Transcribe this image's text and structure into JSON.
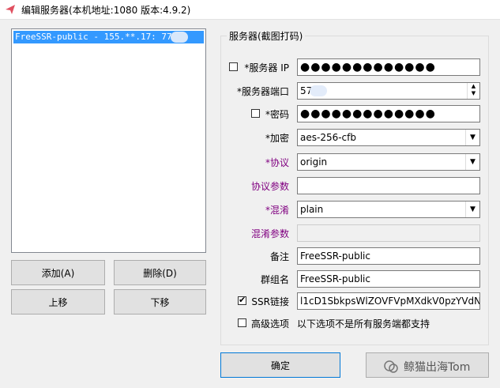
{
  "window": {
    "title": "编辑服务器(本机地址:1080 版本:4.9.2)"
  },
  "server_list": {
    "items": [
      "FreeSSR-public - 155.**.17:   77"
    ]
  },
  "buttons": {
    "add": "添加(A)",
    "delete": "删除(D)",
    "move_up": "上移",
    "move_down": "下移",
    "ok": "确定"
  },
  "form": {
    "group_title": "服务器(截图打码)",
    "server_ip": {
      "label": "*服务器 IP",
      "value": "●●●●●●●●●●●●●",
      "checked": false
    },
    "server_port": {
      "label": "*服务器端口",
      "value": "57"
    },
    "password": {
      "label": "*密码",
      "value": "●●●●●●●●●●●●●",
      "checked": false
    },
    "encryption": {
      "label": "*加密",
      "value": "aes-256-cfb"
    },
    "protocol": {
      "label": "*协议",
      "value": "origin"
    },
    "protocol_param": {
      "label": "协议参数",
      "value": ""
    },
    "obfs": {
      "label": "*混淆",
      "value": "plain"
    },
    "obfs_param": {
      "label": "混淆参数",
      "value": ""
    },
    "remarks": {
      "label": "备注",
      "value": "FreeSSR-public"
    },
    "group_name": {
      "label": "群组名",
      "value": "FreeSSR-public"
    },
    "ssr_link": {
      "label": "SSR链接",
      "value": "l1cD1SbkpsWlZOVFVpMXdkV0pzYVdN",
      "checked": true
    },
    "advanced": {
      "label": "高级选项",
      "note": "以下选项不是所有服务端都支持",
      "checked": false
    }
  },
  "watermark": {
    "text": "鲸猫出海Tom"
  },
  "colors": {
    "selection": "#3399ff",
    "purple_label": "#800080",
    "default_button_border": "#0078d7"
  }
}
